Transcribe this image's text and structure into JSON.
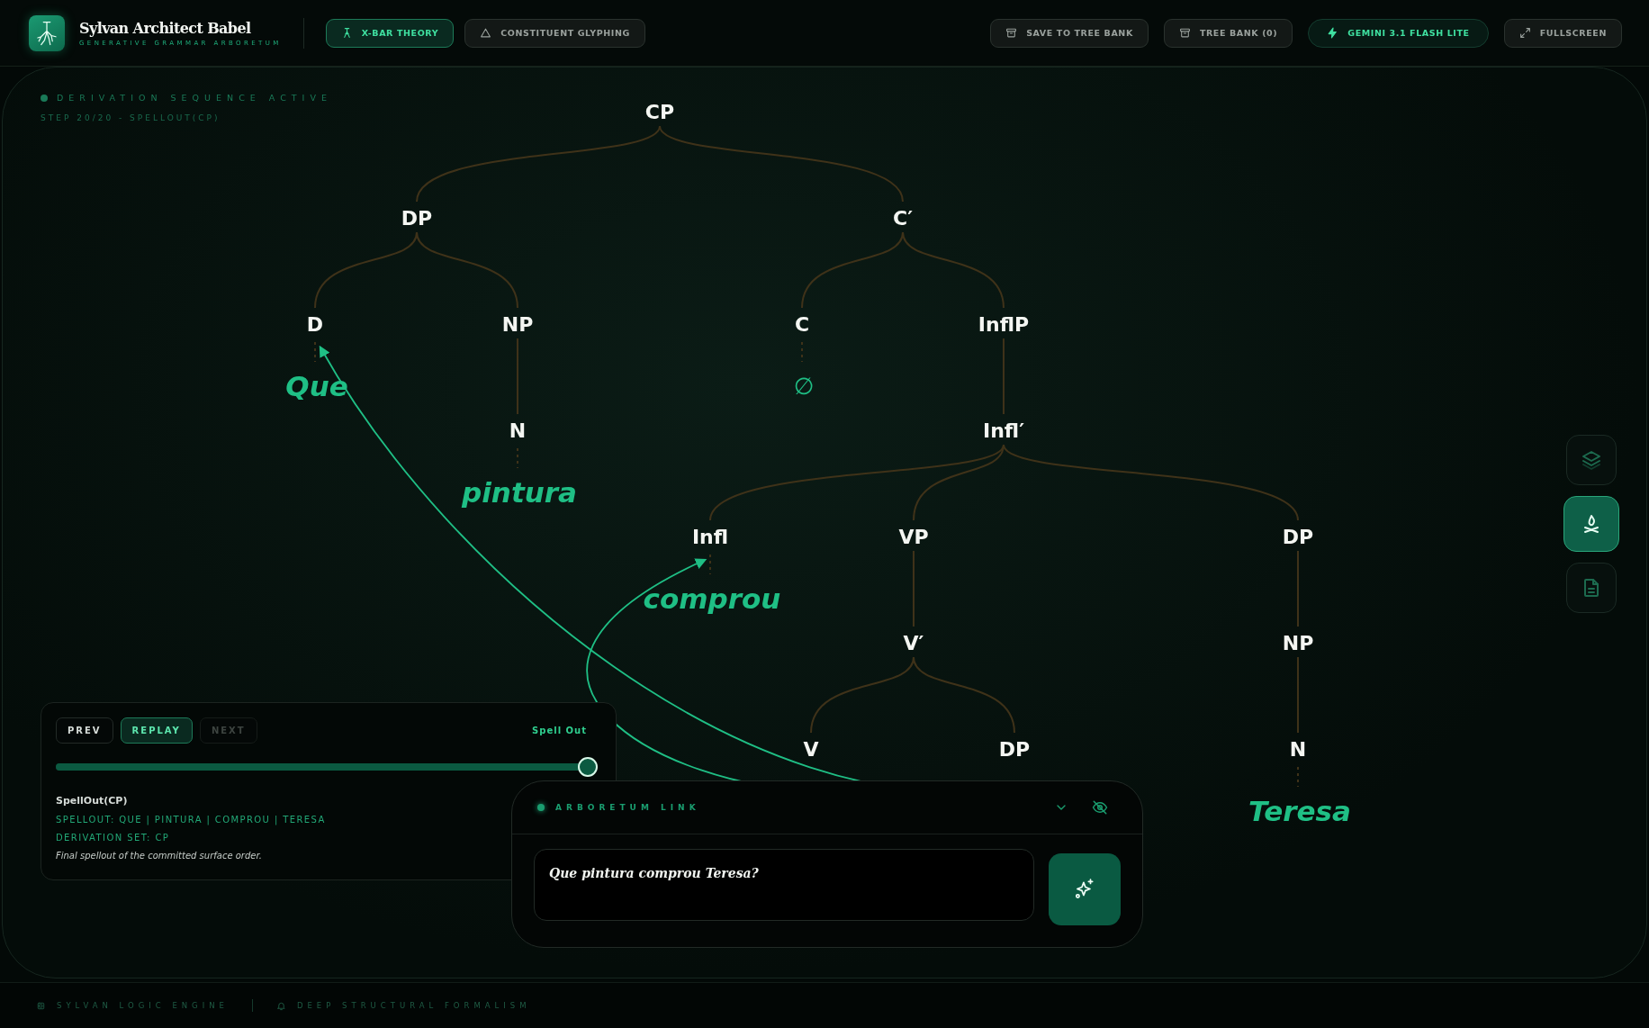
{
  "header": {
    "title": "Sylvan Architect Babel",
    "subtitle": "GENERATIVE GRAMMAR ARBORETUM",
    "modes": [
      {
        "label": "X-BAR THEORY",
        "kind": "xbar",
        "selected": true
      },
      {
        "label": "CONSTITUENT GLYPHING",
        "kind": "triangle",
        "selected": false
      }
    ],
    "actions": [
      {
        "label": "SAVE TO TREE BANK",
        "kind": "archive"
      },
      {
        "label": "TREE BANK (0)",
        "kind": "archive"
      },
      {
        "label": "GEMINI 3.1 FLASH LITE",
        "kind": "model"
      },
      {
        "label": "FULLSCREEN",
        "kind": "expand"
      }
    ]
  },
  "status": {
    "title": "DERIVATION SEQUENCE ACTIVE",
    "step": "STEP 20/20 - SPELLOUT(CP)"
  },
  "tree": {
    "label": "CP",
    "children": [
      {
        "label": "DP",
        "children": [
          {
            "label": "D",
            "word": {
              "text": "Que",
              "kind": "moved"
            }
          },
          {
            "label": "NP",
            "children": [
              {
                "label": "N",
                "word": {
                  "text": "pintura",
                  "kind": "base"
                }
              }
            ]
          }
        ]
      },
      {
        "label": "C′",
        "children": [
          {
            "label": "C",
            "word": {
              "text": "∅",
              "kind": "null"
            }
          },
          {
            "label": "InflP",
            "children": [
              {
                "label": "Infl′",
                "children": [
                  {
                    "label": "Infl",
                    "word": {
                      "text": "comprou",
                      "kind": "moved"
                    }
                  },
                  {
                    "label": "VP",
                    "children": [
                      {
                        "label": "V′",
                        "children": [
                          {
                            "label": "V",
                            "trace": true
                          },
                          {
                            "label": "DP",
                            "trace": true
                          }
                        ]
                      }
                    ]
                  },
                  {
                    "label": "DP",
                    "children": [
                      {
                        "label": "NP",
                        "children": [
                          {
                            "label": "N",
                            "word": {
                              "text": "Teresa",
                              "kind": "base"
                            }
                          }
                        ]
                      }
                    ]
                  }
                ]
              }
            ]
          }
        ]
      }
    ]
  },
  "tools": [
    {
      "kind": "layers",
      "selected": false
    },
    {
      "kind": "tree",
      "selected": true
    },
    {
      "kind": "document",
      "selected": false
    }
  ],
  "step_panel": {
    "buttons": [
      {
        "label": "PREV",
        "selected": false,
        "disabled": false
      },
      {
        "label": "REPLAY",
        "selected": true,
        "disabled": false
      },
      {
        "label": "NEXT",
        "selected": false,
        "disabled": true
      }
    ],
    "phase": "Spell Out",
    "slider": {
      "level": 1
    },
    "title": "SpellOut(CP)",
    "lines": [
      "SPELLOUT: QUE | PINTURA | COMPROU | TERESA",
      "DERIVATION SET: CP"
    ],
    "note": "Final spellout of the committed surface order."
  },
  "chat": {
    "title": "ARBORETUM LINK",
    "input": {
      "value": "Que pintura comprou Teresa?"
    }
  },
  "footer": {
    "items": [
      {
        "label": "SYLVAN LOGIC ENGINE",
        "kind": "chip"
      },
      {
        "label": "DEEP STRUCTURAL FORMALISM",
        "kind": "bell"
      }
    ]
  }
}
